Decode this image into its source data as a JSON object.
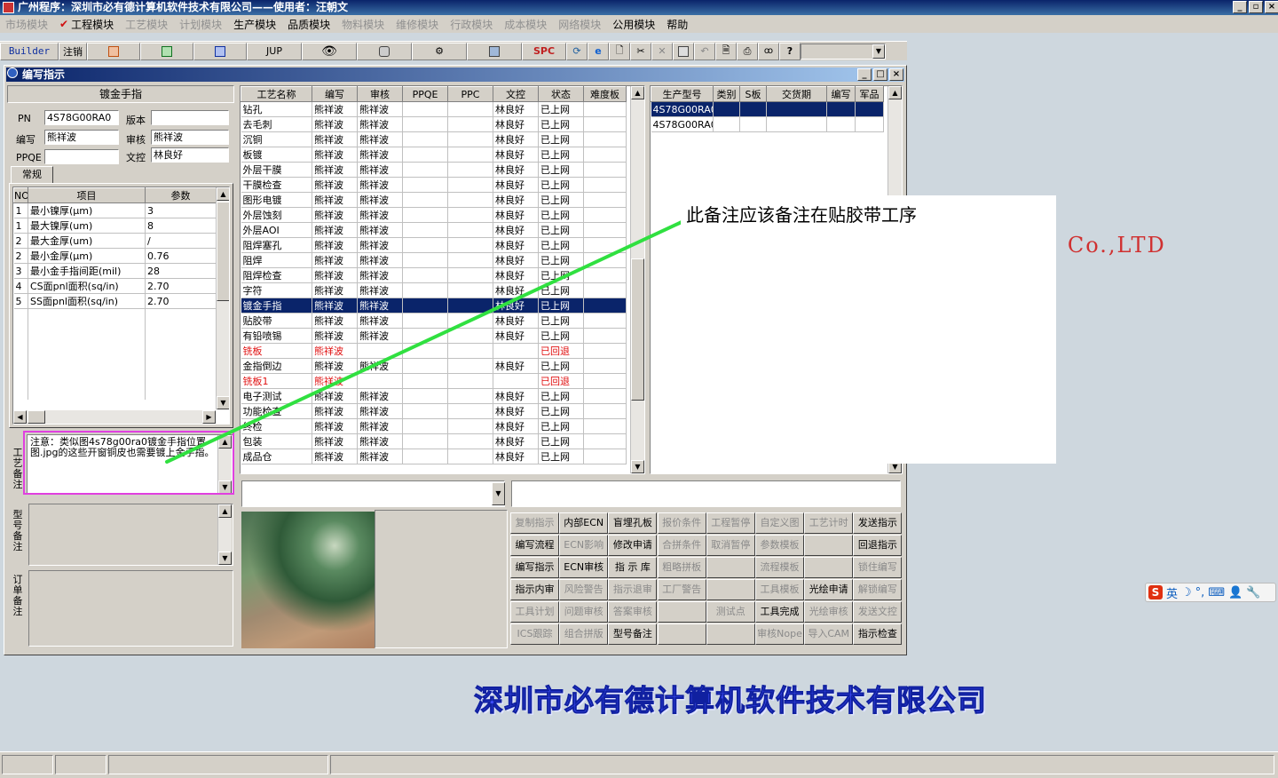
{
  "app": {
    "title": "广州程序：深圳市必有德计算机软件技术有限公司——使用者：汪朝文",
    "window_buttons": [
      "_",
      "▫",
      "×"
    ]
  },
  "menu": [
    {
      "label": "市场模块",
      "enabled": false
    },
    {
      "label": "工程模块",
      "enabled": true,
      "checked": true
    },
    {
      "label": "工艺模块",
      "enabled": false
    },
    {
      "label": "计划模块",
      "enabled": false
    },
    {
      "label": "生产模块",
      "enabled": true
    },
    {
      "label": "品质模块",
      "enabled": true
    },
    {
      "label": "物料模块",
      "enabled": false
    },
    {
      "label": "维修模块",
      "enabled": false
    },
    {
      "label": "行政模块",
      "enabled": false
    },
    {
      "label": "成本模块",
      "enabled": false
    },
    {
      "label": "网络模块",
      "enabled": false
    },
    {
      "label": "公用模块",
      "enabled": true
    },
    {
      "label": "帮助",
      "enabled": true
    }
  ],
  "toolbar": {
    "builder": "Builder",
    "logout": "注销",
    "jup": "JUP",
    "spc": "SPC"
  },
  "company": {
    "name_cn": "深圳市必有德计算机软件技术有限公司",
    "name_en_fragment": "e  Co.,LTD"
  },
  "window": {
    "title": "编写指示",
    "buttons": [
      "_",
      "□",
      "×"
    ]
  },
  "left": {
    "heading": "镀金手指",
    "pn_label": "PN",
    "pn_value": "4S78G00RA0",
    "version_label": "版本",
    "version_value": "",
    "writer_label": "编写",
    "writer_value": "熊祥波",
    "reviewer_label": "审核",
    "reviewer_value": "熊祥波",
    "ppqe_label": "PPQE",
    "ppqe_value": "",
    "doc_label": "文控",
    "doc_value": "林良好",
    "tab": "常规",
    "param_headers": [
      "NO",
      "项目",
      "参数"
    ],
    "params": [
      {
        "no": "1",
        "item": "最小镍厚(μm)",
        "value": "3"
      },
      {
        "no": "1",
        "item": "最大镍厚(um)",
        "value": "8"
      },
      {
        "no": "2",
        "item": "最大金厚(um)",
        "value": "/"
      },
      {
        "no": "2",
        "item": "最小金厚(μm)",
        "value": "0.76"
      },
      {
        "no": "3",
        "item": "最小金手指间距(mil)",
        "value": "28"
      },
      {
        "no": "4",
        "item": "CS面pnl面积(sq/in)",
        "value": "2.70"
      },
      {
        "no": "5",
        "item": "SS面pnl面积(sq/in)",
        "value": "2.70"
      }
    ],
    "process_note_label": "工艺备注",
    "process_note": "注意：类似图4s78g00ra0镀金手指位置图.jpg的这些开窗铜皮也需要镀上金手指。",
    "model_note_label": "型号备注",
    "order_note_label": "订单备注"
  },
  "process_table": {
    "headers": [
      "工艺名称",
      "编写",
      "审核",
      "PPQE",
      "PPC",
      "文控",
      "状态",
      "难度板"
    ],
    "rows": [
      {
        "name": "钻孔",
        "writer": "熊祥波",
        "reviewer": "熊祥波",
        "ppqe": "",
        "ppc": "",
        "doc": "林良好",
        "status": "已上网",
        "diff": ""
      },
      {
        "name": "去毛刺",
        "writer": "熊祥波",
        "reviewer": "熊祥波",
        "ppqe": "",
        "ppc": "",
        "doc": "林良好",
        "status": "已上网",
        "diff": ""
      },
      {
        "name": "沉铜",
        "writer": "熊祥波",
        "reviewer": "熊祥波",
        "ppqe": "",
        "ppc": "",
        "doc": "林良好",
        "status": "已上网",
        "diff": ""
      },
      {
        "name": "板镀",
        "writer": "熊祥波",
        "reviewer": "熊祥波",
        "ppqe": "",
        "ppc": "",
        "doc": "林良好",
        "status": "已上网",
        "diff": ""
      },
      {
        "name": "外层干膜",
        "writer": "熊祥波",
        "reviewer": "熊祥波",
        "ppqe": "",
        "ppc": "",
        "doc": "林良好",
        "status": "已上网",
        "diff": ""
      },
      {
        "name": "干膜检查",
        "writer": "熊祥波",
        "reviewer": "熊祥波",
        "ppqe": "",
        "ppc": "",
        "doc": "林良好",
        "status": "已上网",
        "diff": ""
      },
      {
        "name": "图形电镀",
        "writer": "熊祥波",
        "reviewer": "熊祥波",
        "ppqe": "",
        "ppc": "",
        "doc": "林良好",
        "status": "已上网",
        "diff": ""
      },
      {
        "name": "外层蚀刻",
        "writer": "熊祥波",
        "reviewer": "熊祥波",
        "ppqe": "",
        "ppc": "",
        "doc": "林良好",
        "status": "已上网",
        "diff": ""
      },
      {
        "name": "外层AOI",
        "writer": "熊祥波",
        "reviewer": "熊祥波",
        "ppqe": "",
        "ppc": "",
        "doc": "林良好",
        "status": "已上网",
        "diff": ""
      },
      {
        "name": "阻焊塞孔",
        "writer": "熊祥波",
        "reviewer": "熊祥波",
        "ppqe": "",
        "ppc": "",
        "doc": "林良好",
        "status": "已上网",
        "diff": ""
      },
      {
        "name": "阻焊",
        "writer": "熊祥波",
        "reviewer": "熊祥波",
        "ppqe": "",
        "ppc": "",
        "doc": "林良好",
        "status": "已上网",
        "diff": ""
      },
      {
        "name": "阻焊检查",
        "writer": "熊祥波",
        "reviewer": "熊祥波",
        "ppqe": "",
        "ppc": "",
        "doc": "林良好",
        "status": "已上网",
        "diff": ""
      },
      {
        "name": "字符",
        "writer": "熊祥波",
        "reviewer": "熊祥波",
        "ppqe": "",
        "ppc": "",
        "doc": "林良好",
        "status": "已上网",
        "diff": ""
      },
      {
        "name": "镀金手指",
        "writer": "熊祥波",
        "reviewer": "熊祥波",
        "ppqe": "",
        "ppc": "",
        "doc": "林良好",
        "status": "已上网",
        "diff": "",
        "selected": true
      },
      {
        "name": "贴胶带",
        "writer": "熊祥波",
        "reviewer": "熊祥波",
        "ppqe": "",
        "ppc": "",
        "doc": "林良好",
        "status": "已上网",
        "diff": ""
      },
      {
        "name": "有铅喷锡",
        "writer": "熊祥波",
        "reviewer": "熊祥波",
        "ppqe": "",
        "ppc": "",
        "doc": "林良好",
        "status": "已上网",
        "diff": ""
      },
      {
        "name": "铣板",
        "writer": "熊祥波",
        "reviewer": "",
        "ppqe": "",
        "ppc": "",
        "doc": "",
        "status": "已回退",
        "diff": "",
        "returned": true
      },
      {
        "name": "金指倒边",
        "writer": "熊祥波",
        "reviewer": "熊祥波",
        "ppqe": "",
        "ppc": "",
        "doc": "林良好",
        "status": "已上网",
        "diff": ""
      },
      {
        "name": "铣板1",
        "writer": "熊祥波",
        "reviewer": "",
        "ppqe": "",
        "ppc": "",
        "doc": "",
        "status": "已回退",
        "diff": "",
        "returned": true
      },
      {
        "name": "电子测试",
        "writer": "熊祥波",
        "reviewer": "熊祥波",
        "ppqe": "",
        "ppc": "",
        "doc": "林良好",
        "status": "已上网",
        "diff": ""
      },
      {
        "name": "功能检查",
        "writer": "熊祥波",
        "reviewer": "熊祥波",
        "ppqe": "",
        "ppc": "",
        "doc": "林良好",
        "status": "已上网",
        "diff": ""
      },
      {
        "name": "终检",
        "writer": "熊祥波",
        "reviewer": "熊祥波",
        "ppqe": "",
        "ppc": "",
        "doc": "林良好",
        "status": "已上网",
        "diff": ""
      },
      {
        "name": "包装",
        "writer": "熊祥波",
        "reviewer": "熊祥波",
        "ppqe": "",
        "ppc": "",
        "doc": "林良好",
        "status": "已上网",
        "diff": ""
      },
      {
        "name": "成品仓",
        "writer": "熊祥波",
        "reviewer": "熊祥波",
        "ppqe": "",
        "ppc": "",
        "doc": "林良好",
        "status": "已上网",
        "diff": ""
      }
    ]
  },
  "model_table": {
    "headers": [
      "生产型号",
      "类别",
      "S板",
      "交货期",
      "编写",
      "军品"
    ],
    "rows": [
      {
        "model": "4S78G00RA0",
        "selected": true
      },
      {
        "model": "4S78G00RA0",
        "selected": false
      }
    ]
  },
  "callout_text": "此备注应该备注在贴胶带工序",
  "buttons": [
    [
      "复制指示",
      "内部ECN",
      "盲埋孔板",
      "报价条件",
      "工程暂停",
      "自定义图",
      "工艺计时",
      "发送指示"
    ],
    [
      "编写流程",
      "ECN影响",
      "修改申请",
      "合拼条件",
      "取消暂停",
      "参数模板",
      "",
      "回退指示"
    ],
    [
      "编写指示",
      "ECN审核",
      "指 示 库",
      "粗略拼板",
      "",
      "流程模板",
      "",
      "锁住编写"
    ],
    [
      "指示内审",
      "风险警告",
      "指示退审",
      "工厂警告",
      "",
      "工具模板",
      "光绘申请",
      "解锁编写"
    ],
    [
      "工具计划",
      "问题审核",
      "答案审核",
      "",
      "测试点",
      "工具完成",
      "光绘审核",
      "发送文控"
    ],
    [
      "ICS跟踪",
      "组合拼版",
      "型号备注",
      "",
      "",
      "审核Nope",
      "导入CAM",
      "指示检查"
    ]
  ],
  "buttons_enabled": [
    [
      false,
      true,
      true,
      false,
      false,
      false,
      false,
      true
    ],
    [
      true,
      false,
      true,
      false,
      false,
      false,
      false,
      true
    ],
    [
      true,
      true,
      true,
      false,
      false,
      false,
      false,
      false
    ],
    [
      true,
      false,
      false,
      false,
      false,
      false,
      true,
      false
    ],
    [
      false,
      false,
      false,
      false,
      false,
      true,
      false,
      false
    ],
    [
      false,
      false,
      true,
      false,
      false,
      false,
      false,
      true
    ]
  ],
  "ime": {
    "lang": "英"
  }
}
